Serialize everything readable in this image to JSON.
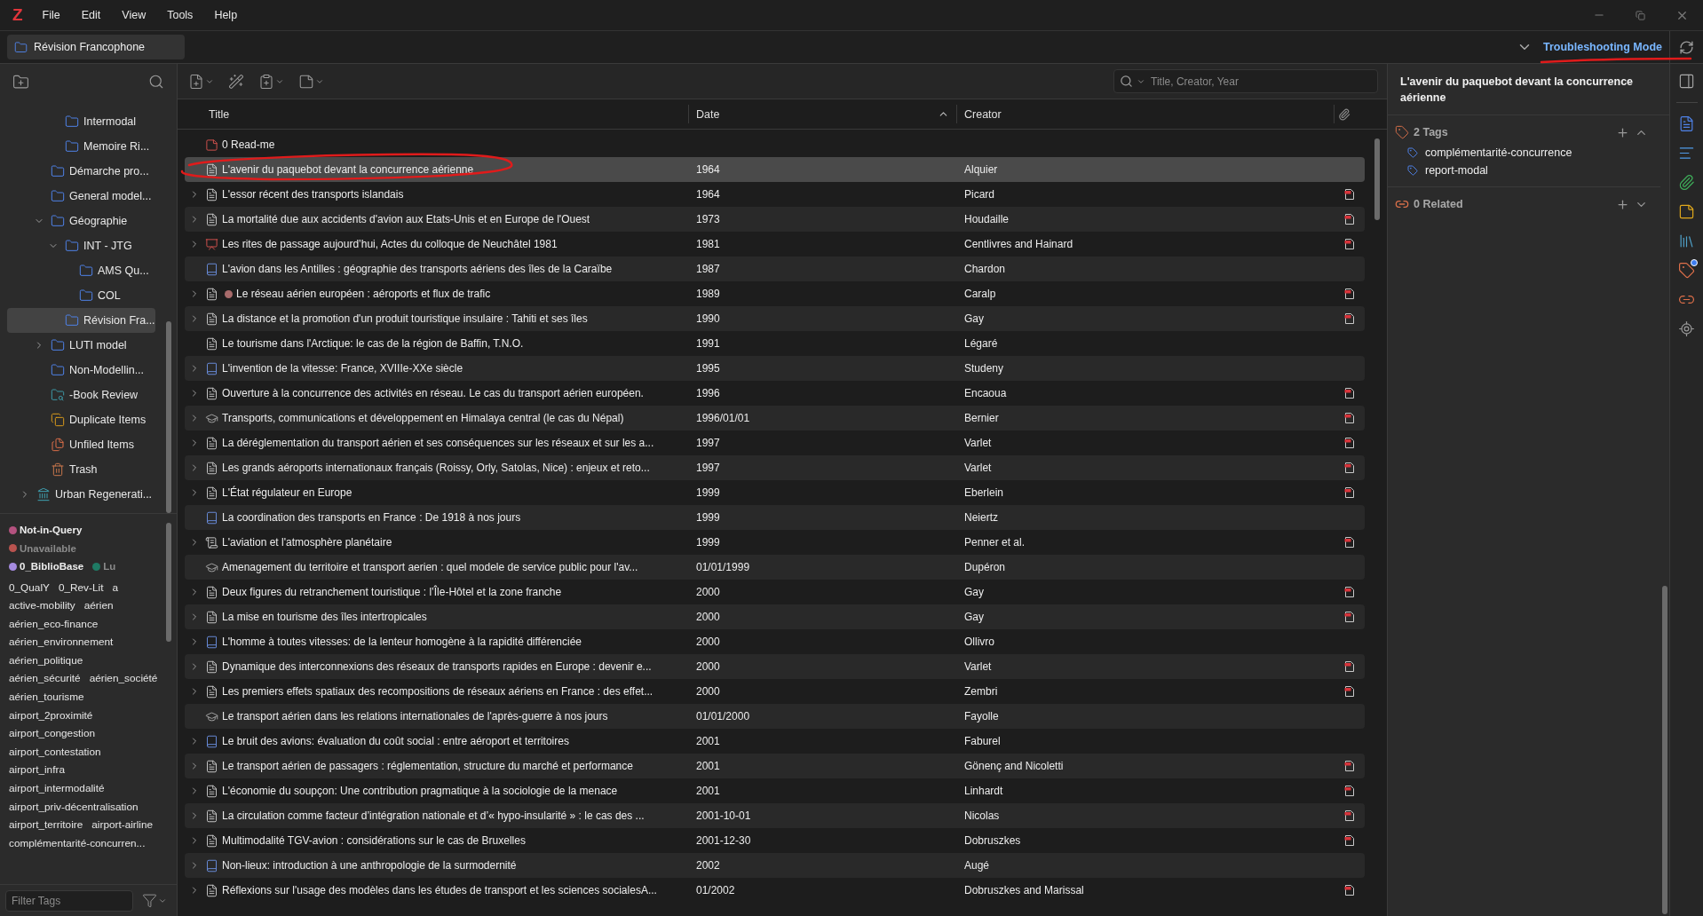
{
  "app_logo": "Z",
  "menu": [
    "File",
    "Edit",
    "View",
    "Tools",
    "Help"
  ],
  "collection_tab": {
    "label": "Révision Francophone"
  },
  "troubleshooting": {
    "label": "Troubleshooting Mode",
    "underlined": true
  },
  "collections": {
    "tree": [
      {
        "children": [
          {
            "label": "Intermodal",
            "kind": "collection",
            "selected": false
          },
          {
            "label": "Memoire Ri...",
            "kind": "collection",
            "selected": false
          }
        ]
      },
      {
        "label": "Démarche pro...",
        "kind": "collection",
        "selected": false
      },
      {
        "label": "General model...",
        "kind": "collection",
        "selected": false
      },
      {
        "label": "Géographie",
        "kind": "collection",
        "selected": false,
        "expanded": true,
        "children": [
          {
            "label": "INT - JTG",
            "kind": "collection",
            "selected": false,
            "expanded": true,
            "children": [
              {
                "label": "AMS Qu...",
                "kind": "collection",
                "selected": false
              },
              {
                "label": "COL",
                "kind": "collection",
                "selected": false
              }
            ]
          },
          {
            "label": "Révision Fra...",
            "kind": "collection",
            "selected": true
          }
        ]
      },
      {
        "label": "LUTI model",
        "kind": "collection",
        "selected": false,
        "expanded": false
      },
      {
        "label": "Non-Modellin...",
        "kind": "collection",
        "selected": false
      },
      {
        "label": "-Book Review",
        "kind": "saved_search",
        "selected": false
      },
      {
        "label": "Duplicate Items",
        "kind": "duplicates",
        "selected": false
      },
      {
        "label": "Unfiled Items",
        "kind": "unfiled",
        "selected": false
      },
      {
        "label": "Trash",
        "kind": "trash",
        "selected": false
      }
    ],
    "groups": [
      {
        "label": "Urban Regenerati...",
        "kind": "group",
        "selected": false,
        "expanded": false
      }
    ]
  },
  "tag_selector": {
    "colored_tags": [
      {
        "label": "Not-in-Query",
        "color": "#b4527f",
        "disabled": false
      },
      {
        "label": "Unavailable",
        "color": "#b9534f",
        "disabled": true
      },
      {
        "label": "0_BiblioBase",
        "color": "#a58be0",
        "disabled": false
      },
      {
        "label": "Lu",
        "color": "#1f7a64",
        "disabled": true
      }
    ],
    "tags": [
      "0_QualY",
      "0_Rev-Lit",
      "a",
      "active-mobility",
      "aérien",
      "aérien_eco-finance",
      "aérien_environnement",
      "aérien_politique",
      "aérien_sécurité",
      "aérien_société",
      "aérien_tourisme",
      "airport_2proximité",
      "airport_congestion",
      "airport_contestation",
      "airport_infra",
      "airport_intermodalité",
      "airport_priv-décentralisation",
      "airport_territoire",
      "airport-airline",
      "complémentarité-concurren..."
    ],
    "filter": {
      "placeholder": "Filter Tags"
    }
  },
  "items_search": {
    "placeholder": "Title, Creator, Year"
  },
  "table": {
    "columns": [
      {
        "kind": "text",
        "label": "Title",
        "sorted": false
      },
      {
        "kind": "text",
        "label": "Date",
        "sorted": true
      },
      {
        "kind": "text",
        "label": "Creator",
        "sorted": false
      },
      {
        "kind": "attachments"
      }
    ],
    "rows": [
      {
        "title": "0 Read-me",
        "kind": "note",
        "expandable": false,
        "pdf": false,
        "selected": false,
        "circled": false
      },
      {
        "title": "L'avenir du paquebot devant la concurrence aérienne",
        "date": "1964",
        "creator": "Alquier",
        "kind": "document",
        "expandable": false,
        "pdf": false,
        "selected": true,
        "circled": true
      },
      {
        "title": "L'essor récent des transports islandais",
        "date": "1964",
        "creator": "Picard",
        "kind": "document",
        "expandable": true,
        "pdf": true,
        "selected": false,
        "circled": false
      },
      {
        "title": "La mortalité due aux accidents d'avion aux Etats-Unis et en Europe de l'Ouest",
        "date": "1973",
        "creator": "Houdaille",
        "kind": "document",
        "expandable": true,
        "pdf": true,
        "selected": false,
        "circled": false
      },
      {
        "title": "Les rites de passage aujourd’hui, Actes du colloque de Neuchâtel 1981",
        "date": "1981",
        "creator": "Centlivres and Hainard",
        "kind": "conference",
        "expandable": true,
        "pdf": true,
        "selected": false,
        "circled": false
      },
      {
        "title": "L'avion dans les Antilles : géographie des transports aériens des îles de la Caraïbe",
        "date": "1987",
        "creator": "Chardon",
        "kind": "book",
        "expandable": false,
        "pdf": false,
        "selected": false,
        "circled": false
      },
      {
        "title": "Le réseau aérien européen : aéroports et flux de trafic",
        "date": "1989",
        "creator": "Caralp",
        "kind": "document",
        "expandable": true,
        "pdf": true,
        "selected": false,
        "circled": false,
        "color": "#a86b6b"
      },
      {
        "title": "La distance et la promotion d'un produit touristique insulaire : Tahiti et ses îles",
        "date": "1990",
        "creator": "Gay",
        "kind": "document",
        "expandable": true,
        "pdf": true,
        "selected": false,
        "circled": false
      },
      {
        "title": "Le tourisme dans l'Arctique: le cas de la région de Baffin, T.N.O.",
        "date": "1991",
        "creator": "Légaré",
        "kind": "document",
        "expandable": false,
        "pdf": false,
        "selected": false,
        "circled": false
      },
      {
        "title": "L'invention de la vitesse: France, XVIIIe-XXe siècle",
        "date": "1995",
        "creator": "Studeny",
        "kind": "book",
        "expandable": true,
        "pdf": false,
        "selected": false,
        "circled": false
      },
      {
        "title": "Ouverture à la concurrence des activités en réseau. Le cas du transport aérien européen.",
        "date": "1996",
        "creator": "Encaoua",
        "kind": "document",
        "expandable": true,
        "pdf": true,
        "selected": false,
        "circled": false
      },
      {
        "title": "Transports, communications et développement en Himalaya central (le cas du Népal)",
        "date": "1996/01/01",
        "creator": "Bernier",
        "kind": "thesis",
        "expandable": true,
        "pdf": true,
        "selected": false,
        "circled": false
      },
      {
        "title": "La déréglementation du transport aérien et ses conséquences sur les réseaux et sur les a...",
        "date": "1997",
        "creator": "Varlet",
        "kind": "document",
        "expandable": true,
        "pdf": true,
        "selected": false,
        "circled": false
      },
      {
        "title": "Les grands aéroports internationaux français (Roissy, Orly, Satolas, Nice) : enjeux et reto...",
        "date": "1997",
        "creator": "Varlet",
        "kind": "document",
        "expandable": true,
        "pdf": true,
        "selected": false,
        "circled": false
      },
      {
        "title": "L'État régulateur en Europe",
        "date": "1999",
        "creator": "Eberlein",
        "kind": "document",
        "expandable": true,
        "pdf": true,
        "selected": false,
        "circled": false
      },
      {
        "title": "La coordination des transports en France : De 1918 à nos jours",
        "date": "1999",
        "creator": "Neiertz",
        "kind": "book",
        "expandable": false,
        "pdf": false,
        "selected": false,
        "circled": false
      },
      {
        "title": "L'aviation et l'atmosphère planétaire",
        "date": "1999",
        "creator": "Penner et al.",
        "kind": "report",
        "expandable": true,
        "pdf": true,
        "selected": false,
        "circled": false
      },
      {
        "title": "Amenagement du territoire et transport aerien : quel modele de service public pour l'av...",
        "date": "01/01/1999",
        "creator": "Dupéron",
        "kind": "thesis",
        "expandable": false,
        "pdf": false,
        "selected": false,
        "circled": false
      },
      {
        "title": "Deux figures du retranchement touristique : l’Île-Hôtel et la zone franche",
        "date": "2000",
        "creator": "Gay",
        "kind": "document",
        "expandable": true,
        "pdf": true,
        "selected": false,
        "circled": false
      },
      {
        "title": "La mise en tourisme des îles intertropicales",
        "date": "2000",
        "creator": "Gay",
        "kind": "document",
        "expandable": true,
        "pdf": true,
        "selected": false,
        "circled": false
      },
      {
        "title": "L'homme à toutes vitesses: de la lenteur homogène à la rapidité différenciée",
        "date": "2000",
        "creator": "Ollivro",
        "kind": "book",
        "expandable": true,
        "pdf": false,
        "selected": false,
        "circled": false
      },
      {
        "title": "Dynamique des interconnexions des réseaux de transports rapides en Europe : devenir e...",
        "date": "2000",
        "creator": "Varlet",
        "kind": "document",
        "expandable": true,
        "pdf": true,
        "selected": false,
        "circled": false
      },
      {
        "title": "Les premiers effets spatiaux des recompositions de réseaux aériens en France : des effet...",
        "date": "2000",
        "creator": "Zembri",
        "kind": "document",
        "expandable": true,
        "pdf": true,
        "selected": false,
        "circled": false
      },
      {
        "title": "Le transport aérien dans les relations internationales de l'après-guerre à nos jours",
        "date": "01/01/2000",
        "creator": "Fayolle",
        "kind": "thesis",
        "expandable": false,
        "pdf": false,
        "selected": false,
        "circled": false
      },
      {
        "title": "Le bruit des avions: évaluation du coût social : entre aéroport et territoires",
        "date": "2001",
        "creator": "Faburel",
        "kind": "book",
        "expandable": true,
        "pdf": false,
        "selected": false,
        "circled": false
      },
      {
        "title": "Le transport aérien de passagers : réglementation, structure du marché et performance",
        "date": "2001",
        "creator": "Gönenç and Nicoletti",
        "kind": "document",
        "expandable": true,
        "pdf": true,
        "selected": false,
        "circled": false
      },
      {
        "title": "L'économie du soupçon: Une contribution pragmatique à la sociologie de la menace",
        "date": "2001",
        "creator": "Linhardt",
        "kind": "document",
        "expandable": true,
        "pdf": true,
        "selected": false,
        "circled": false
      },
      {
        "title": "La circulation comme facteur d’intégration nationale et d’« hypo-insularité » : le cas des ...",
        "date": "2001-10-01",
        "creator": "Nicolas",
        "kind": "document",
        "expandable": true,
        "pdf": true,
        "selected": false,
        "circled": false
      },
      {
        "title": "Multimodalité TGV-avion : considérations sur le cas de Bruxelles",
        "date": "2001-12-30",
        "creator": "Dobruszkes",
        "kind": "document",
        "expandable": true,
        "pdf": true,
        "selected": false,
        "circled": false
      },
      {
        "title": "Non-lieux: introduction à une anthropologie de la surmodernité",
        "date": "2002",
        "creator": "Augé",
        "kind": "book",
        "expandable": true,
        "pdf": false,
        "selected": false,
        "circled": false
      },
      {
        "title": "Réflexions sur l'usage des modèles dans les études de transport et les sciences socialesA...",
        "date": "01/2002",
        "creator": "Dobruszkes and Marissal",
        "kind": "document",
        "expandable": true,
        "pdf": true,
        "selected": false,
        "circled": false
      }
    ]
  },
  "item_pane": {
    "title": "L'avenir du paquebot devant la concurrence aérienne",
    "tags": {
      "header": "2 Tags",
      "expanded": true,
      "items": [
        "complémentarité-concurrence",
        "report-modal"
      ]
    },
    "related": {
      "header": "0 Related",
      "expanded": false
    }
  }
}
